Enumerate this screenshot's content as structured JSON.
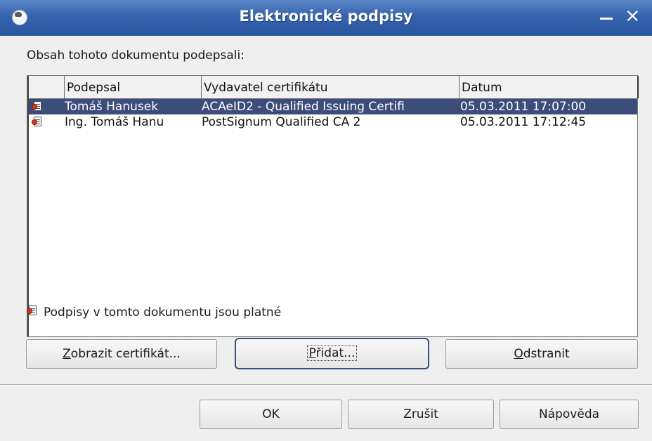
{
  "window": {
    "title": "Elektronické podpisy",
    "icon": "app-icon",
    "minimize": "minimize-icon",
    "close": "×"
  },
  "intro_label": "Obsah tohoto dokumentu podepsali:",
  "table": {
    "columns": [
      "",
      "Podepsal",
      "Vydavatel certifikátu",
      "Datum"
    ],
    "rows": [
      {
        "signed_by": "Tomáš Hanusek",
        "issuer": "ACAeID2 - Qualified Issuing Certifi",
        "date": "05.03.2011 17:07:00",
        "selected": true
      },
      {
        "signed_by": "Ing. Tomáš Hanu",
        "issuer": "PostSignum Qualified CA 2",
        "date": "05.03.2011 17:12:45",
        "selected": false
      }
    ]
  },
  "status": "Podpisy v tomto dokumentu jsou platné",
  "buttons": {
    "view_cert_underlined": "Z",
    "view_cert_rest": "obrazit certifikát...",
    "add_underlined": "P",
    "add_rest": "řidat...",
    "remove_underlined": "O",
    "remove_rest": "dstranit",
    "ok": "OK",
    "cancel": "Zrušit",
    "help": "Nápověda"
  },
  "colors": {
    "titlebar": "#3563ae",
    "selection": "#3d4d7b",
    "dialog_bg": "#efefef"
  }
}
